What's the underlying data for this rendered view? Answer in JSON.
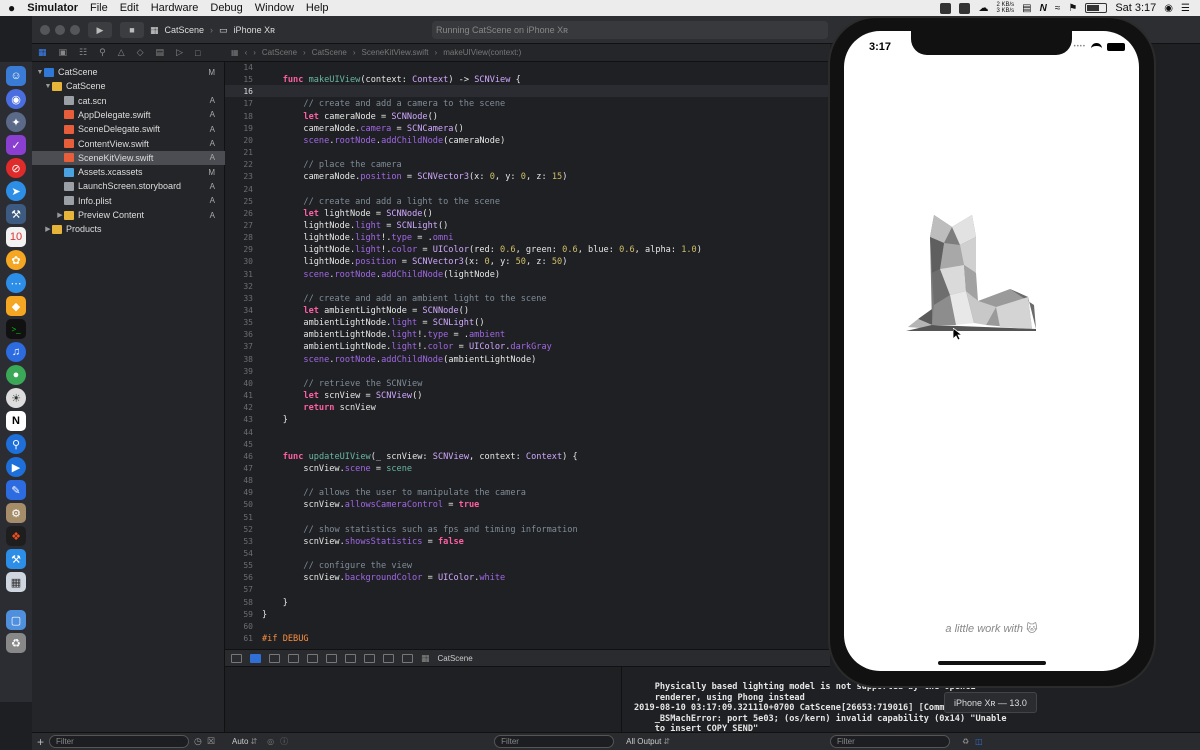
{
  "menubar": {
    "app": "Simulator",
    "items": [
      "File",
      "Edit",
      "Hardware",
      "Debug",
      "Window",
      "Help"
    ],
    "net_up": "2 KB/s",
    "net_down": "3 KB/s",
    "clock": "Sat 3:17"
  },
  "toolbar": {
    "scheme": "CatScene",
    "destination": "iPhone Xʀ",
    "status": "Running CatScene on iPhone Xʀ"
  },
  "jumpbar": [
    "CatScene",
    "CatScene",
    "SceneKitView.swift",
    "makeUIView(context:)"
  ],
  "navigator": {
    "rows": [
      {
        "name": "CatScene",
        "badge": "M",
        "kind": "proj",
        "indent": 0,
        "disc": "▼"
      },
      {
        "name": "CatScene",
        "badge": "",
        "kind": "folder",
        "indent": 1,
        "disc": "▼"
      },
      {
        "name": "cat.scn",
        "badge": "A",
        "kind": "doc",
        "indent": 2,
        "disc": ""
      },
      {
        "name": "AppDelegate.swift",
        "badge": "A",
        "kind": "swift",
        "indent": 2,
        "disc": ""
      },
      {
        "name": "SceneDelegate.swift",
        "badge": "A",
        "kind": "swift",
        "indent": 2,
        "disc": ""
      },
      {
        "name": "ContentView.swift",
        "badge": "A",
        "kind": "swift",
        "indent": 2,
        "disc": ""
      },
      {
        "name": "SceneKitView.swift",
        "badge": "A",
        "kind": "swift",
        "indent": 2,
        "disc": "",
        "selected": true
      },
      {
        "name": "Assets.xcassets",
        "badge": "M",
        "kind": "xca",
        "indent": 2,
        "disc": ""
      },
      {
        "name": "LaunchScreen.storyboard",
        "badge": "A",
        "kind": "doc",
        "indent": 2,
        "disc": ""
      },
      {
        "name": "Info.plist",
        "badge": "A",
        "kind": "doc",
        "indent": 2,
        "disc": ""
      },
      {
        "name": "Preview Content",
        "badge": "A",
        "kind": "folder",
        "indent": 2,
        "disc": "▶"
      },
      {
        "name": "Products",
        "badge": "",
        "kind": "folder",
        "indent": 1,
        "disc": "▶"
      }
    ],
    "filter_placeholder": "Filter"
  },
  "editor": {
    "current_line": 16,
    "lines": [
      [
        14,
        ""
      ],
      [
        15,
        "    <span class='k'>func</span> <span class='f'>makeUIView</span>(context: <span class='t'>Context</span>) -> <span class='t'>SCNView</span> {"
      ],
      [
        16,
        ""
      ],
      [
        17,
        "        <span class='c'>// create and add a camera to the scene</span>"
      ],
      [
        18,
        "        <span class='k'>let</span> cameraNode = <span class='t'>SCNNode</span>()"
      ],
      [
        19,
        "        cameraNode.<span class='m'>camera</span> = <span class='t'>SCNCamera</span>()"
      ],
      [
        20,
        "        <span class='m'>scene</span>.<span class='m'>rootNode</span>.<span class='m'>addChildNode</span>(cameraNode)"
      ],
      [
        21,
        ""
      ],
      [
        22,
        "        <span class='c'>// place the camera</span>"
      ],
      [
        23,
        "        cameraNode.<span class='m'>position</span> = <span class='t'>SCNVector3</span>(x: <span class='n'>0</span>, y: <span class='n'>0</span>, z: <span class='n'>15</span>)"
      ],
      [
        24,
        ""
      ],
      [
        25,
        "        <span class='c'>// create and add a light to the scene</span>"
      ],
      [
        26,
        "        <span class='k'>let</span> lightNode = <span class='t'>SCNNode</span>()"
      ],
      [
        27,
        "        lightNode.<span class='m'>light</span> = <span class='t'>SCNLight</span>()"
      ],
      [
        28,
        "        lightNode.<span class='m'>light</span>!.<span class='m'>type</span> = .<span class='m'>omni</span>"
      ],
      [
        29,
        "        lightNode.<span class='m'>light</span>!.<span class='m'>color</span> = <span class='t'>UIColor</span>(red: <span class='n'>0.6</span>, green: <span class='n'>0.6</span>, blue: <span class='n'>0.6</span>, alpha: <span class='n'>1.0</span>)"
      ],
      [
        30,
        "        lightNode.<span class='m'>position</span> = <span class='t'>SCNVector3</span>(x: <span class='n'>0</span>, y: <span class='n'>50</span>, z: <span class='n'>50</span>)"
      ],
      [
        31,
        "        <span class='m'>scene</span>.<span class='m'>rootNode</span>.<span class='m'>addChildNode</span>(lightNode)"
      ],
      [
        32,
        ""
      ],
      [
        33,
        "        <span class='c'>// create and add an ambient light to the scene</span>"
      ],
      [
        34,
        "        <span class='k'>let</span> ambientLightNode = <span class='t'>SCNNode</span>()"
      ],
      [
        35,
        "        ambientLightNode.<span class='m'>light</span> = <span class='t'>SCNLight</span>()"
      ],
      [
        36,
        "        ambientLightNode.<span class='m'>light</span>!.<span class='m'>type</span> = .<span class='m'>ambient</span>"
      ],
      [
        37,
        "        ambientLightNode.<span class='m'>light</span>!.<span class='m'>color</span> = <span class='t'>UIColor</span>.<span class='m'>darkGray</span>"
      ],
      [
        38,
        "        <span class='m'>scene</span>.<span class='m'>rootNode</span>.<span class='m'>addChildNode</span>(ambientLightNode)"
      ],
      [
        39,
        ""
      ],
      [
        40,
        "        <span class='c'>// retrieve the SCNView</span>"
      ],
      [
        41,
        "        <span class='k'>let</span> scnView = <span class='t'>SCNView</span>()"
      ],
      [
        42,
        "        <span class='k'>return</span> scnView"
      ],
      [
        43,
        "    }"
      ],
      [
        44,
        ""
      ],
      [
        45,
        ""
      ],
      [
        46,
        "    <span class='k'>func</span> <span class='f'>updateUIView</span>(_ scnView: <span class='t'>SCNView</span>, context: <span class='t'>Context</span>) {"
      ],
      [
        47,
        "        scnView.<span class='m'>scene</span> = <span class='f'>scene</span>"
      ],
      [
        48,
        ""
      ],
      [
        49,
        "        <span class='c'>// allows the user to manipulate the camera</span>"
      ],
      [
        50,
        "        scnView.<span class='m'>allowsCameraControl</span> = <span class='k'>true</span>"
      ],
      [
        51,
        ""
      ],
      [
        52,
        "        <span class='c'>// show statistics such as fps and timing information</span>"
      ],
      [
        53,
        "        scnView.<span class='m'>showsStatistics</span> = <span class='k'>false</span>"
      ],
      [
        54,
        ""
      ],
      [
        55,
        "        <span class='c'>// configure the view</span>"
      ],
      [
        56,
        "        scnView.<span class='m'>backgroundColor</span> = <span class='t'>UIColor</span>.<span class='m'>white</span>"
      ],
      [
        57,
        ""
      ],
      [
        58,
        "    }"
      ],
      [
        59,
        "}"
      ],
      [
        60,
        ""
      ],
      [
        61,
        "<span class='pp'>#if DEBUG</span>"
      ]
    ]
  },
  "debugbar": {
    "target": "CatScene"
  },
  "console": {
    "lines": [
      "    Physically based lighting model is not supported by the OpenGL",
      "    renderer, using Phong instead",
      "2019-08-10 03:17:09.321110+0700 CatScene[26653:719016] [Common]",
      "    _BSMachError: port 5e03; (os/kern) invalid capability (0x14) \"Unable",
      "    to insert COPY_SEND\""
    ]
  },
  "bottombar": {
    "auto_label": "Auto",
    "filter_placeholder": "Filter",
    "output_label": "All Output",
    "console_filter_placeholder": "Filter"
  },
  "simulator": {
    "time": "3:17",
    "caption": "a little work with 🐱",
    "device_tooltip": "iPhone Xʀ — 13.0"
  },
  "colors": {
    "accent": "#2f6fd6",
    "keyword": "#fc5fa3",
    "comment": "#7f8c98"
  }
}
